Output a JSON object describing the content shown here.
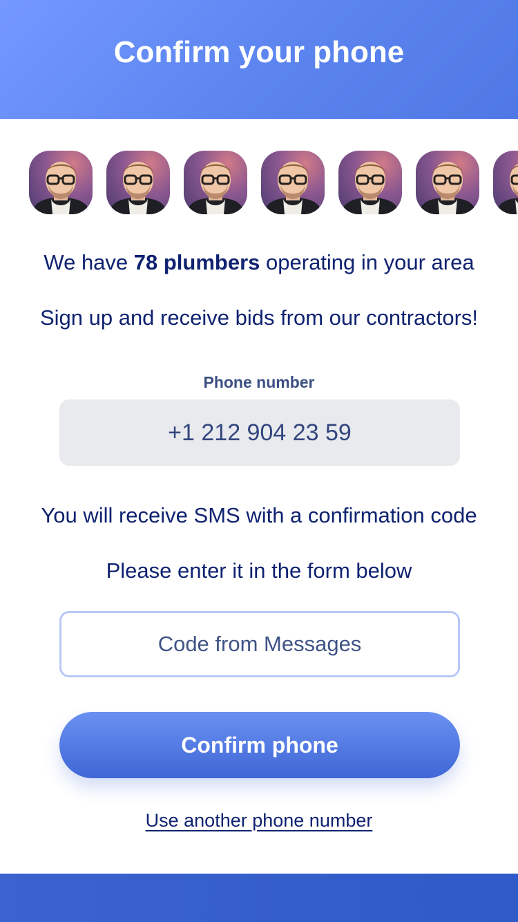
{
  "header": {
    "title": "Confirm your phone"
  },
  "avatars": {
    "count": 7,
    "icon": "contractor-avatar"
  },
  "info": {
    "prefix": "We have ",
    "highlight": "78 plumbers",
    "suffix": " operating in your area",
    "signup": "Sign up and receive bids from our contractors!"
  },
  "phone": {
    "label": "Phone number",
    "value": "+1 212 904 23 59"
  },
  "sms": {
    "line1": "You will receive SMS with a confirmation code",
    "line2": "Please enter it in the form below"
  },
  "code": {
    "placeholder": "Code from Messages",
    "value": ""
  },
  "actions": {
    "confirm_label": "Confirm phone",
    "alt_link": "Use another phone number"
  },
  "colors": {
    "header": "#5b84ef",
    "button": "#4f78e4",
    "text": "#0f2270",
    "footer": "#2f5ac7"
  }
}
